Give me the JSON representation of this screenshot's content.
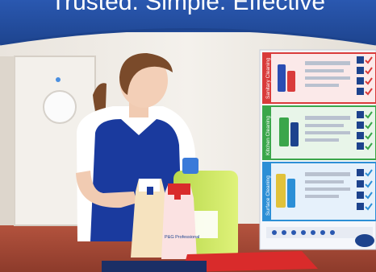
{
  "header": {
    "tagline": "Trusted. Simple. Effective"
  },
  "chart": {
    "sections": [
      {
        "label": "Sanitary Cleaning",
        "color": "#d93b3b"
      },
      {
        "label": "Kitchen Cleaning",
        "color": "#3aa64a"
      },
      {
        "label": "Surface Cleaning",
        "color": "#2c8fd6"
      }
    ]
  },
  "bottles": {
    "brand_label": "P&G Professional"
  },
  "colors": {
    "header_blue": "#1d438d",
    "apron_blue": "#1a3a9e",
    "accent_red": "#d92b2b"
  }
}
